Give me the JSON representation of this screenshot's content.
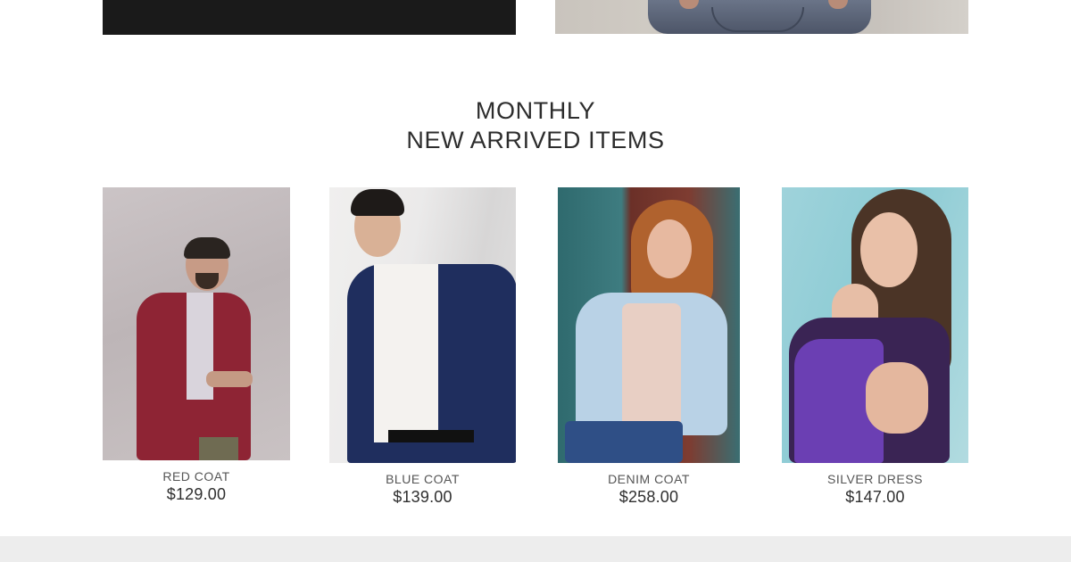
{
  "section": {
    "title_line1": "MONTHLY",
    "title_line2": "NEW ARRIVED ITEMS"
  },
  "products": [
    {
      "name": "RED COAT",
      "price": "$129.00"
    },
    {
      "name": "BLUE COAT",
      "price": "$139.00"
    },
    {
      "name": "DENIM COAT",
      "price": "$258.00"
    },
    {
      "name": "SILVER DRESS",
      "price": "$147.00"
    }
  ],
  "colors": {
    "heading_text": "#2d2d2d",
    "product_name_text": "#555555",
    "price_text": "#2f2f2f",
    "footer_band": "#ededed"
  }
}
